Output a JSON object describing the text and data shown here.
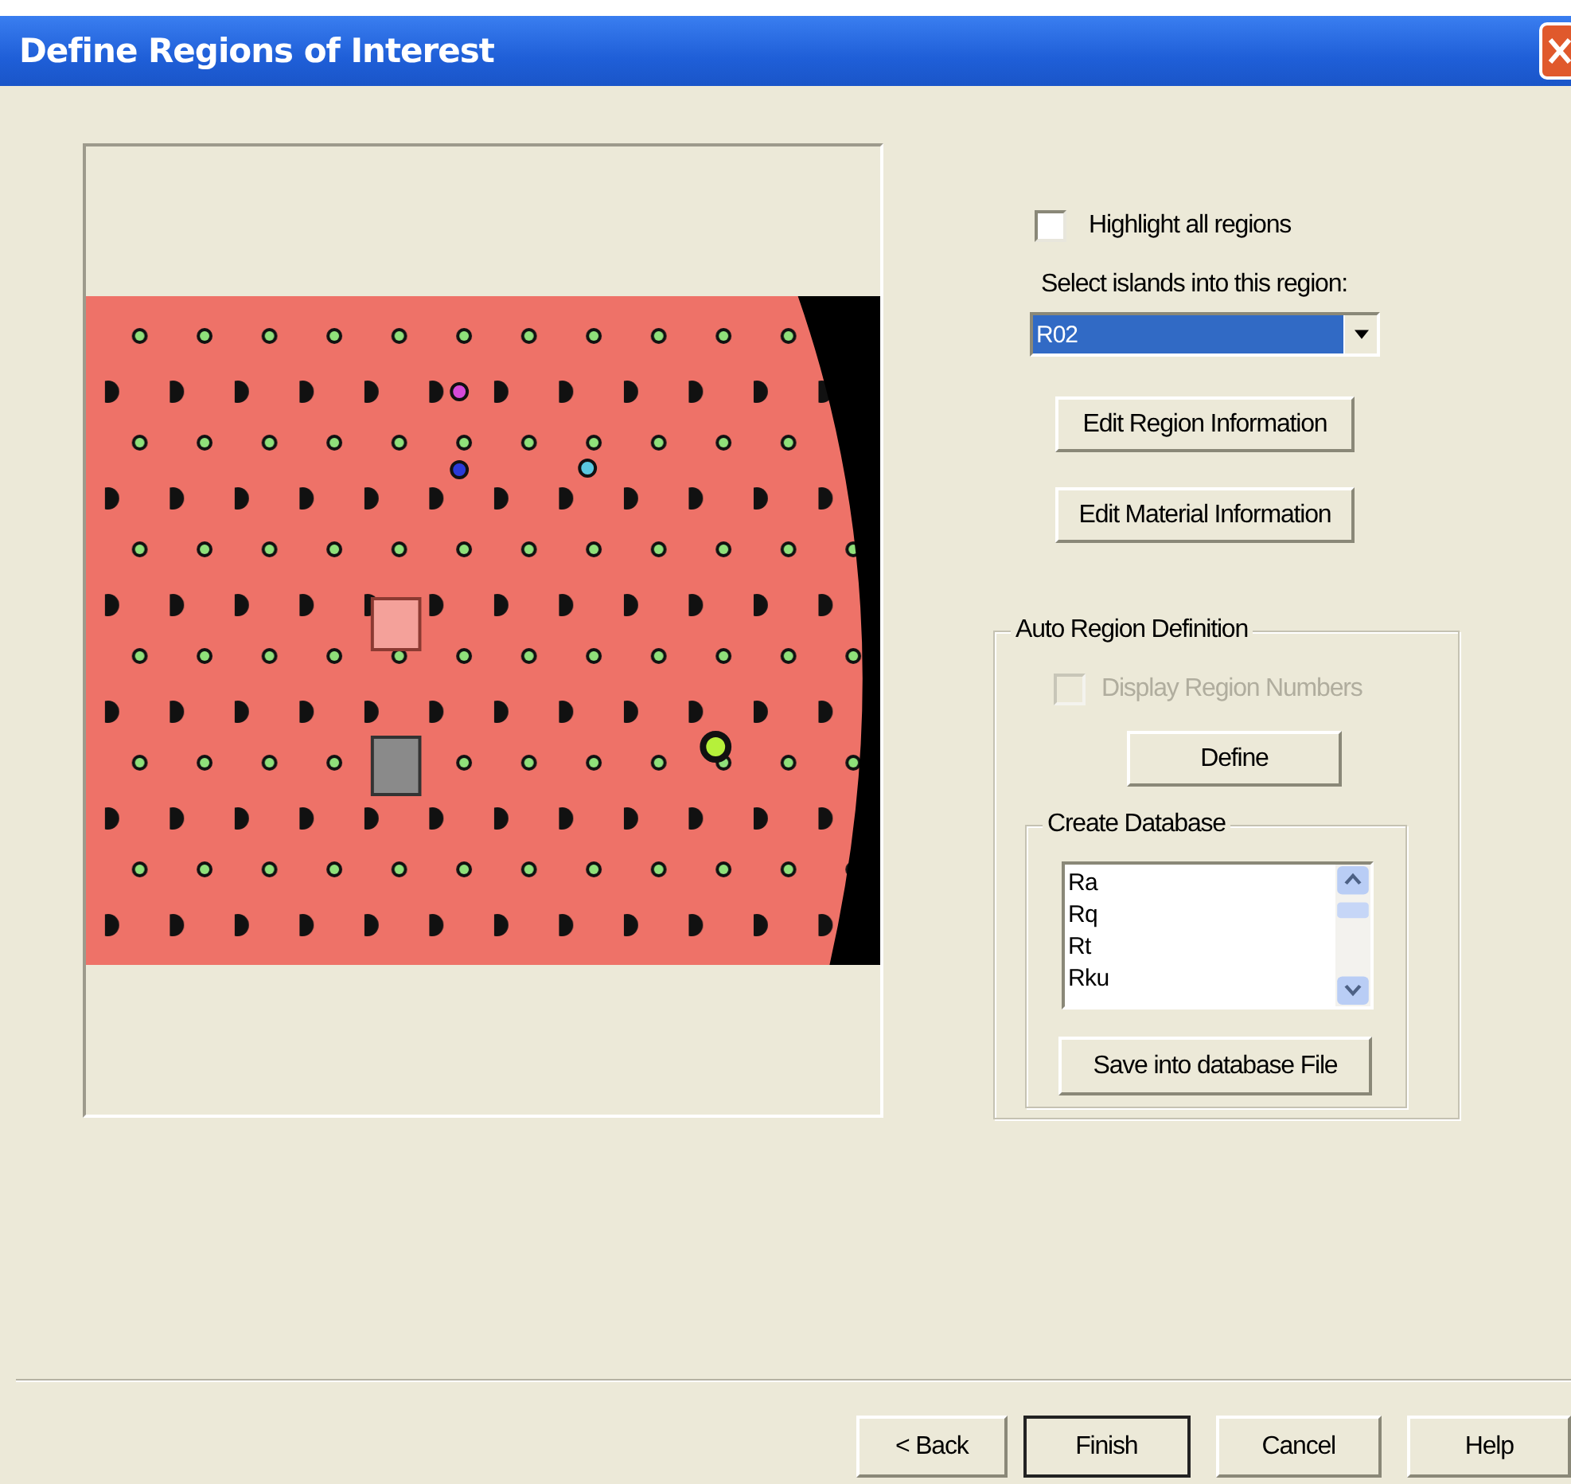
{
  "window": {
    "title": "Define Regions of Interest"
  },
  "highlight_all": {
    "label": "Highlight all regions",
    "checked": false
  },
  "region_select": {
    "label": "Select islands into this region:",
    "value": "R02",
    "selected": true
  },
  "buttons_top": [
    {
      "label": "Edit Region Information"
    },
    {
      "label": "Edit Material Information"
    }
  ],
  "auto_region": {
    "title": "Auto Region Definition",
    "display_numbers": {
      "label": "Display Region Numbers",
      "checked": false,
      "disabled": true
    },
    "define_button": "Define",
    "create_database": {
      "title": "Create Database",
      "items": [
        "Ra",
        "Rq",
        "Rt",
        "Rku"
      ],
      "save_button": "Save into database File"
    }
  },
  "footer_buttons": [
    {
      "label": "< Back",
      "default": false
    },
    {
      "label": "Finish",
      "default": true
    },
    {
      "label": "Cancel",
      "default": false
    },
    {
      "label": "Help",
      "default": false
    }
  ]
}
